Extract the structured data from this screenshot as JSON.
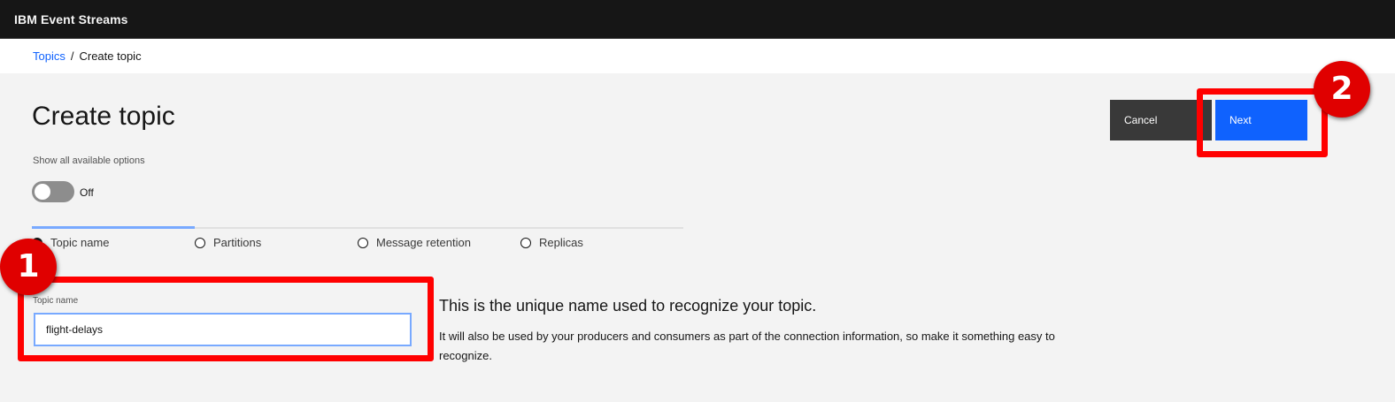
{
  "app": {
    "title": "IBM Event Streams"
  },
  "breadcrumb": {
    "parent": "Topics",
    "separator": "/",
    "current": "Create topic"
  },
  "page": {
    "title": "Create topic"
  },
  "options": {
    "show_all_label": "Show all available options",
    "toggle_state": "Off"
  },
  "steps": [
    {
      "label": "Topic name",
      "current": true
    },
    {
      "label": "Partitions",
      "current": false
    },
    {
      "label": "Message retention",
      "current": false
    },
    {
      "label": "Replicas",
      "current": false
    }
  ],
  "buttons": {
    "cancel": "Cancel",
    "next": "Next"
  },
  "form": {
    "topic_name_label": "Topic name",
    "topic_name_value": "flight-delays"
  },
  "help": {
    "title": "This is the unique name used to recognize your topic.",
    "body": "It will also be used by your producers and consumers as part of the connection information, so make it something easy to recognize."
  },
  "annotations": [
    {
      "number": "1"
    },
    {
      "number": "2"
    }
  ],
  "colors": {
    "accent": "#0f62fe",
    "annotation": "#ff0000",
    "header_bg": "#161616"
  }
}
